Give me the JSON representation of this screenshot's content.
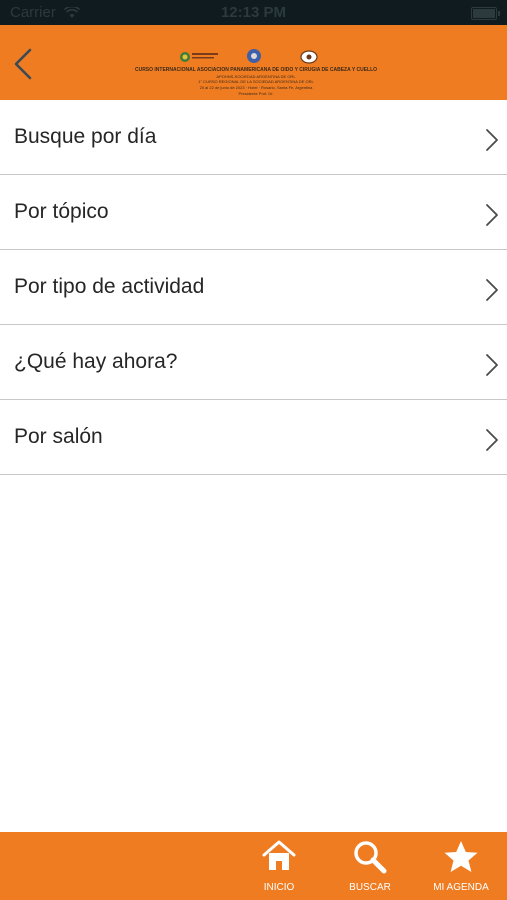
{
  "status_bar": {
    "carrier": "Carrier",
    "time": "12:13 PM"
  },
  "header": {
    "back_icon": "chevron-left-icon",
    "banner": {
      "line1": "CURSO INTERNACIONAL ASOCIACIÓN PANAMERICANA DE OÍDO Y CIRUGÍA DE CABEZA Y CUELLO",
      "line2": "APOHNS-SOCIEDAD ARGENTINA DE ORL",
      "line3": "1° CURSO REGIONAL DE LA SOCIEDAD ARGENTINA DE ORL",
      "line4": "20 al 22 de junio de 2023 · Hotel · Rosario, Santa Fe, Argentina",
      "line5": "Presidente Prof. Dr."
    }
  },
  "menu": {
    "items": [
      {
        "label": "Busque por día"
      },
      {
        "label": "Por tópico"
      },
      {
        "label": "Por tipo de actividad"
      },
      {
        "label": "¿Qué hay ahora?"
      },
      {
        "label": "Por salón"
      }
    ]
  },
  "tab_bar": {
    "inicio": {
      "label": "INICIO",
      "icon": "home-icon"
    },
    "buscar": {
      "label": "BUSCAR",
      "icon": "search-icon"
    },
    "agenda": {
      "label": "MI AGENDA",
      "icon": "star-icon"
    }
  },
  "colors": {
    "accent": "#f07c22",
    "status_bar": "#0f1b1e",
    "divider": "#c8c8c8"
  }
}
